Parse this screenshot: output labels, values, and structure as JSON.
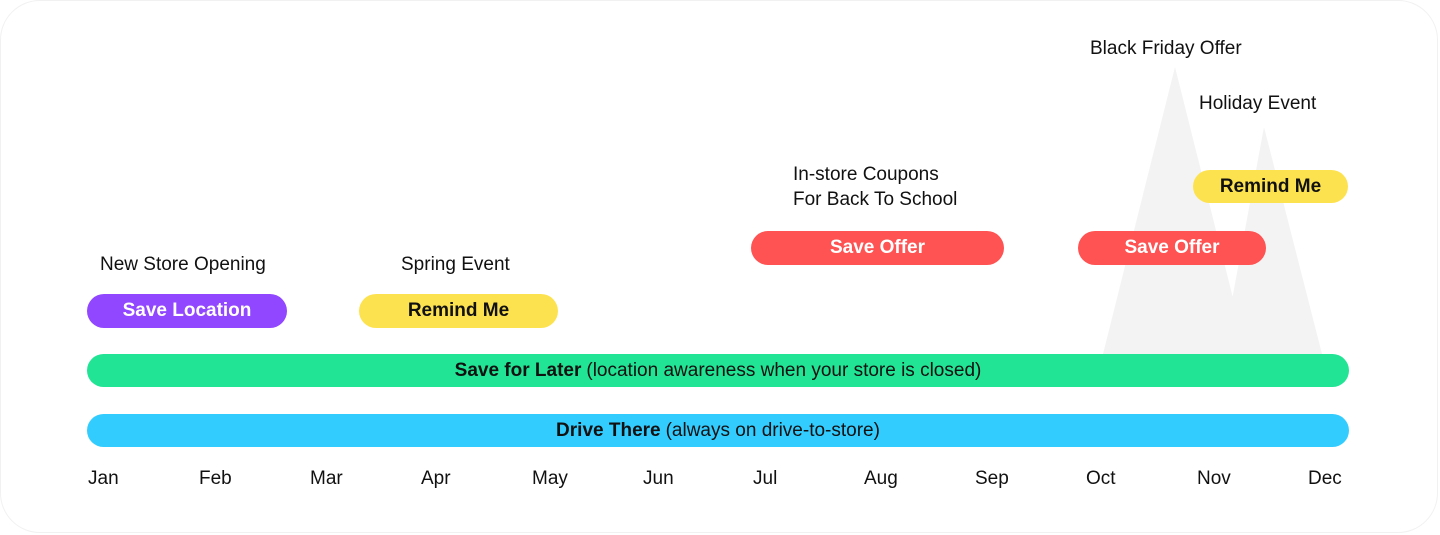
{
  "colors": {
    "purple": "#9146ff",
    "yellow": "#fde24f",
    "red": "#ff5252",
    "green": "#21e494",
    "blue": "#33ccff",
    "peak": "#f3f3f3"
  },
  "events": [
    {
      "label": "New Store Opening",
      "button": "Save Location"
    },
    {
      "label": "Spring Event",
      "button": "Remind Me"
    },
    {
      "label_line1": "In-store Coupons",
      "label_line2": "For Back To School",
      "button": "Save Offer"
    },
    {
      "label": "Black Friday Offer",
      "button": "Save Offer"
    },
    {
      "label": "Holiday Event",
      "button": "Remind Me"
    }
  ],
  "bars": [
    {
      "bold": "Save for Later",
      "rest": "(location awareness when your store is closed)"
    },
    {
      "bold": "Drive There",
      "rest": "(always on drive-to-store)"
    }
  ],
  "months": [
    "Jan",
    "Feb",
    "Mar",
    "Apr",
    "May",
    "Jun",
    "Jul",
    "Aug",
    "Sep",
    "Oct",
    "Nov",
    "Dec"
  ]
}
